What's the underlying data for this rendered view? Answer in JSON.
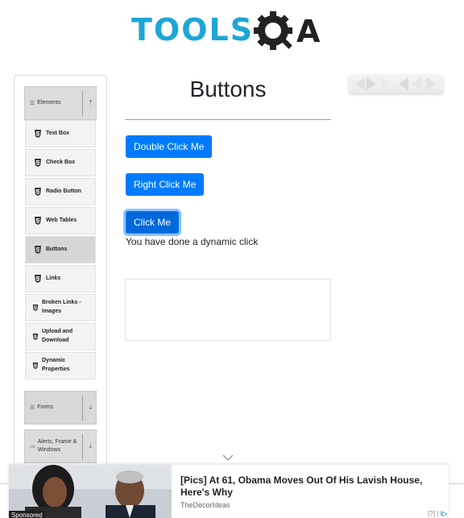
{
  "brand": {
    "wordmark": "TOOLS",
    "mark_letters": "QA"
  },
  "sidebar": {
    "elements_group": {
      "label": "Elements",
      "icon": "list-icon",
      "toggle": "collapse-arrow-icon"
    },
    "items": [
      {
        "label": "Text Box",
        "icon": "html5-icon"
      },
      {
        "label": "Check Box",
        "icon": "html5-icon"
      },
      {
        "label": "Radio Button",
        "icon": "html5-icon"
      },
      {
        "label": "Web Tables",
        "icon": "html5-icon"
      },
      {
        "label": "Buttons",
        "icon": "html5-icon",
        "active": true
      },
      {
        "label": "Links",
        "icon": "html5-icon"
      },
      {
        "label": "Broken Links - Images",
        "icon": "html5-icon"
      },
      {
        "label": "Upload and Download",
        "icon": "html5-icon"
      },
      {
        "label": "Dynamic Properties",
        "icon": "html5-icon"
      }
    ],
    "forms_group": {
      "label": "Forms",
      "icon": "list-icon",
      "toggle": "expand-arrow-icon"
    },
    "alerts_group": {
      "label": "Alerts, Frame & Windows",
      "icon": "window-icon",
      "toggle": "expand-arrow-icon"
    }
  },
  "main": {
    "title": "Buttons",
    "double_click_label": "Double Click Me",
    "right_click_label": "Right Click Me",
    "click_label": "Click Me",
    "result_text": "You have done a dynamic click"
  },
  "ad": {
    "headline": "[Pics] At 61, Obama Moves Out Of His Lavish House, Here's Why",
    "source": "TheDecorIdeas",
    "sponsored_label": "Sponsored",
    "adchoices_label": "[?] |"
  },
  "colors": {
    "primary_button": "#007bff",
    "brand_blue": "#1ea6d6",
    "sidebar_header": "#dcdcdc"
  }
}
